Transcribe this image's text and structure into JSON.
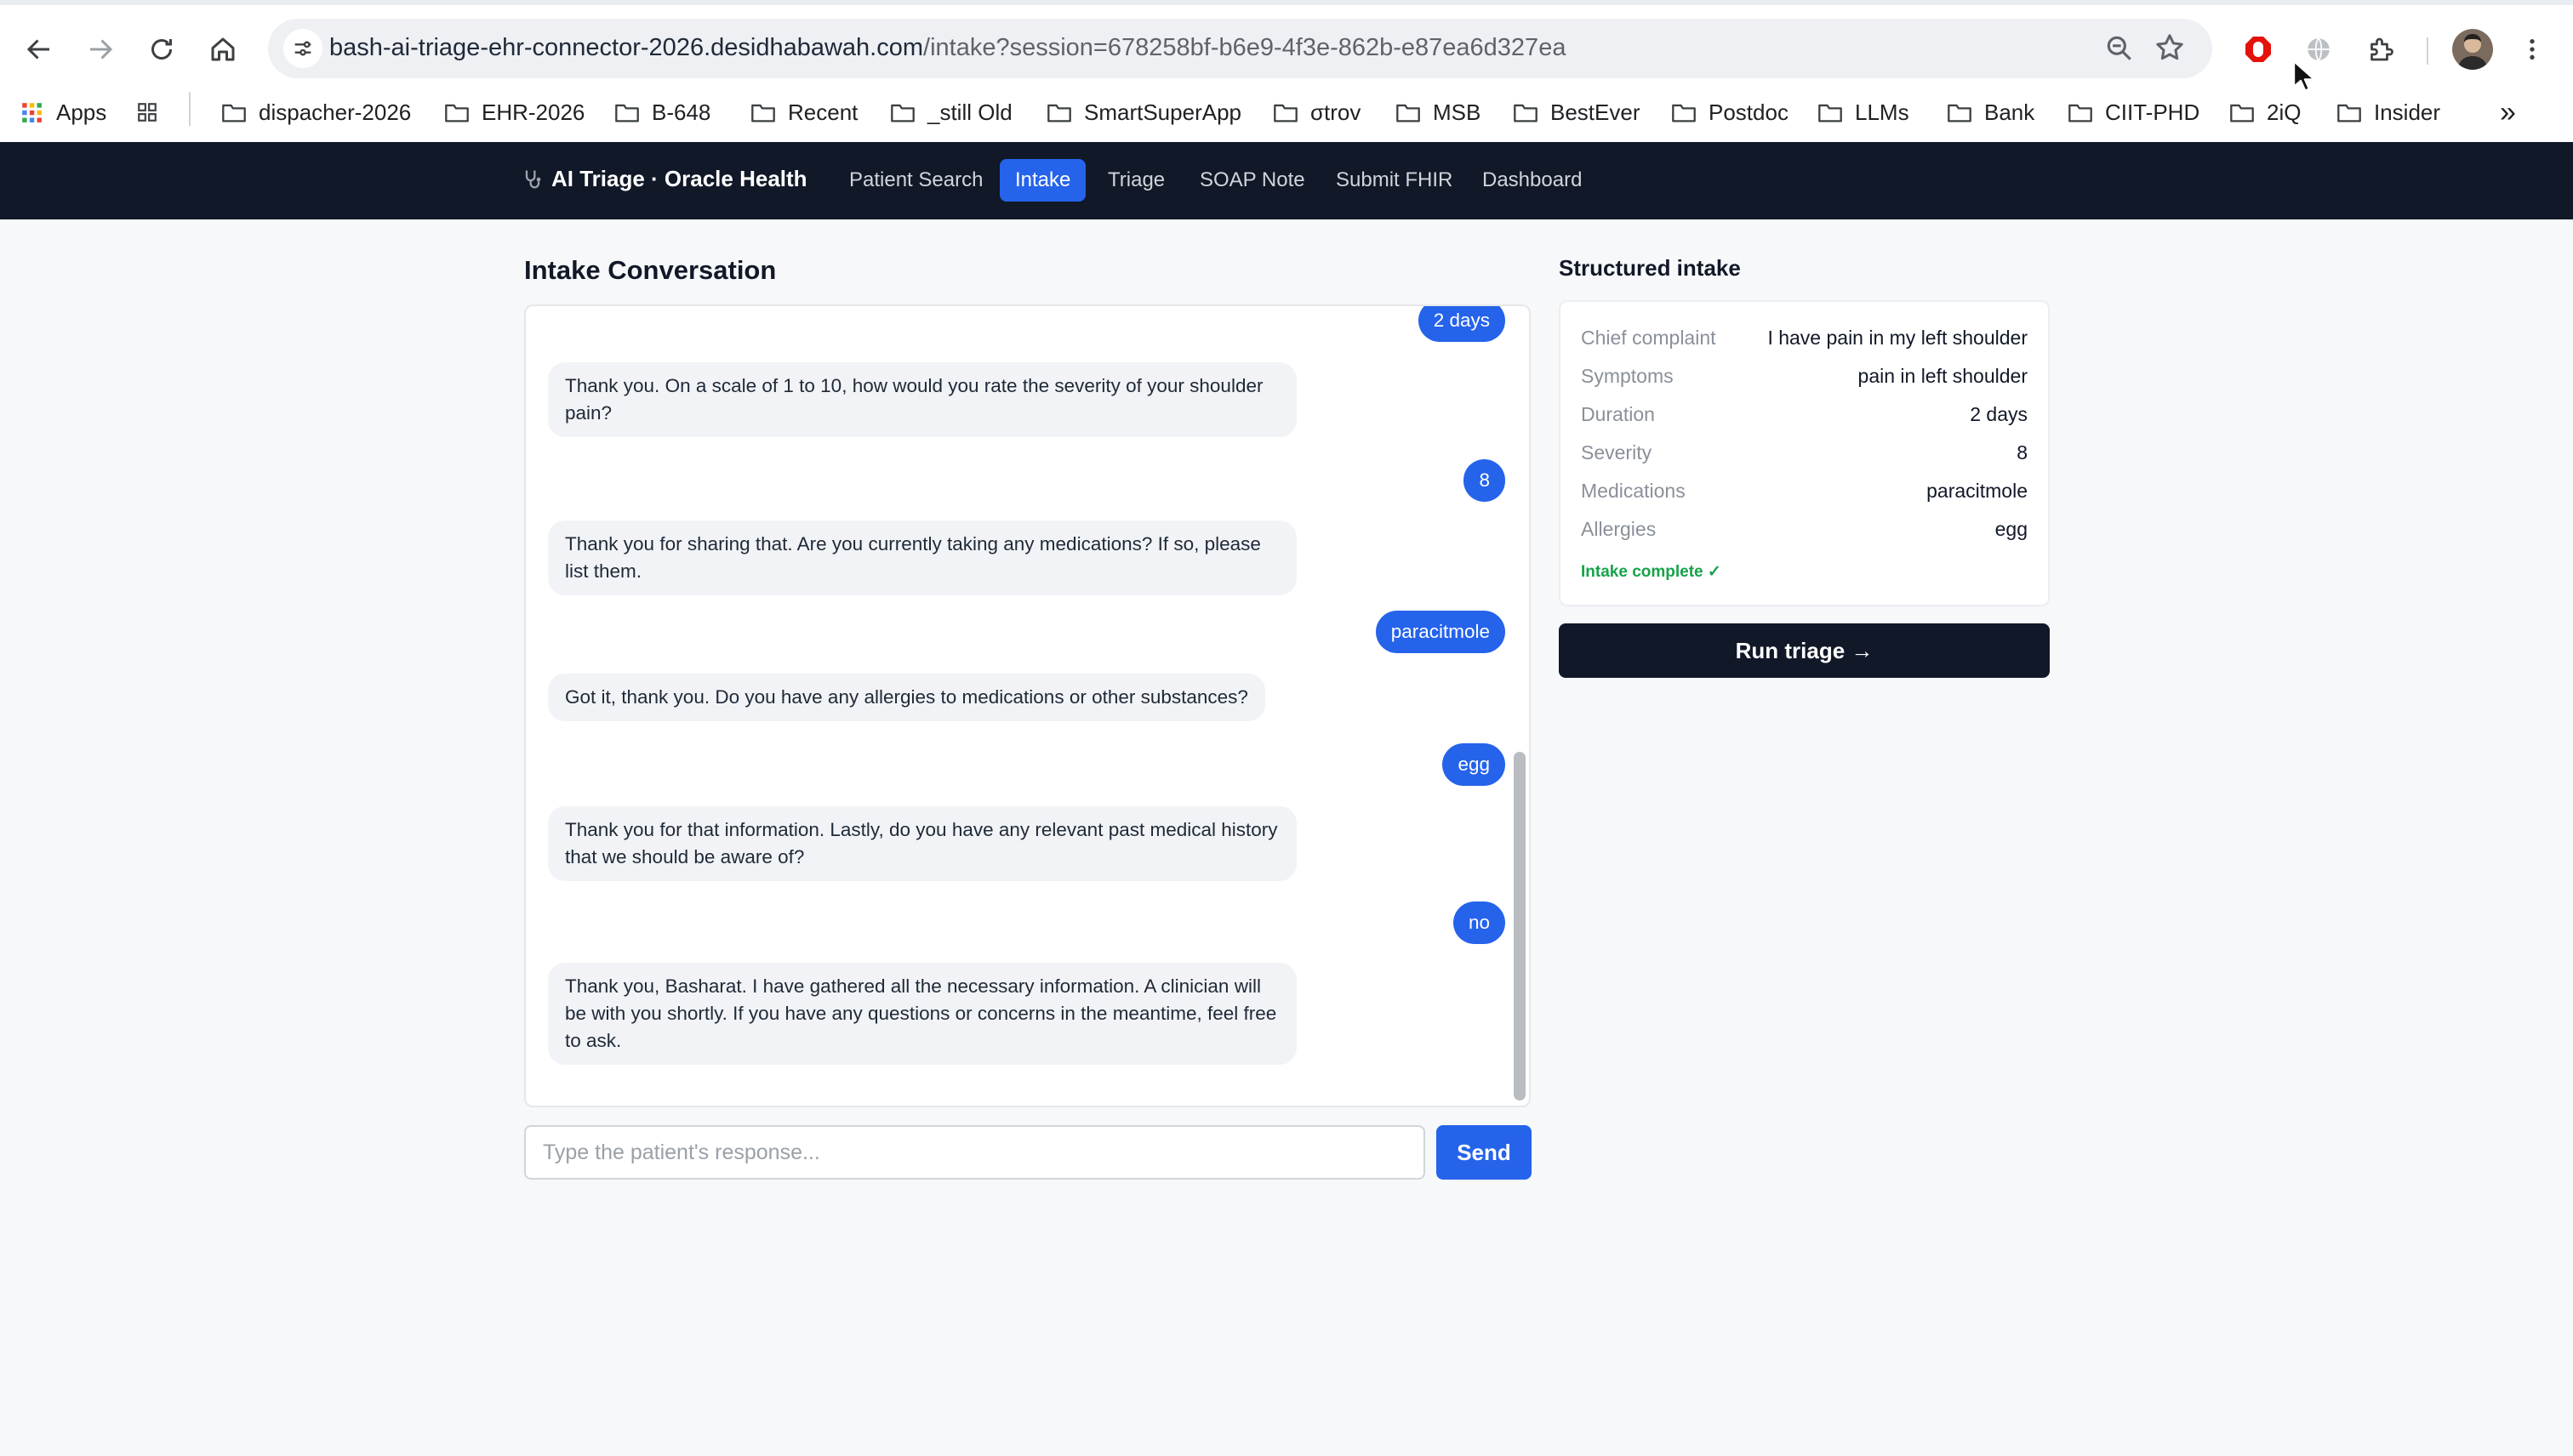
{
  "browser": {
    "url_host": "bash-ai-triage-ehr-connector-2026.desidhabawah.com",
    "url_path": "/intake?session=678258bf-b6e9-4f3e-862b-e87ea6d327ea",
    "bookmarks": [
      {
        "label": "Apps",
        "icon": "apps-grid-icon"
      },
      {
        "label": "dispacher-2026",
        "icon": "folder-icon"
      },
      {
        "label": "EHR-2026",
        "icon": "folder-icon"
      },
      {
        "label": "B-648",
        "icon": "folder-icon"
      },
      {
        "label": "Recent",
        "icon": "folder-icon"
      },
      {
        "label": "_still Old",
        "icon": "folder-icon"
      },
      {
        "label": "SmartSuperApp",
        "icon": "folder-icon"
      },
      {
        "label": "σtrov",
        "icon": "folder-icon"
      },
      {
        "label": "MSB",
        "icon": "folder-icon"
      },
      {
        "label": "BestEver",
        "icon": "folder-icon"
      },
      {
        "label": "Postdoc",
        "icon": "folder-icon"
      },
      {
        "label": "LLMs",
        "icon": "folder-icon"
      },
      {
        "label": "Bank",
        "icon": "folder-icon"
      },
      {
        "label": "CIIT-PHD",
        "icon": "folder-icon"
      },
      {
        "label": "2iQ",
        "icon": "folder-icon"
      },
      {
        "label": "Insider",
        "icon": "folder-icon"
      }
    ],
    "more_bookmarks": "»"
  },
  "app": {
    "brand": "AI Triage · Oracle Health",
    "nav": [
      {
        "label": "Patient Search",
        "active": false
      },
      {
        "label": "Intake",
        "active": true
      },
      {
        "label": "Triage",
        "active": false
      },
      {
        "label": "SOAP Note",
        "active": false
      },
      {
        "label": "Submit FHIR",
        "active": false
      },
      {
        "label": "Dashboard",
        "active": false
      }
    ],
    "accent_color": "#2563eb",
    "nav_bg_color": "#111827"
  },
  "conversation": {
    "title": "Intake Conversation",
    "messages": [
      {
        "role": "user",
        "text": "2 days"
      },
      {
        "role": "assistant",
        "text": "Thank you. On a scale of 1 to 10, how would you rate the severity of your shoulder pain?"
      },
      {
        "role": "user",
        "text": "8"
      },
      {
        "role": "assistant",
        "text": "Thank you for sharing that. Are you currently taking any medications? If so, please list them."
      },
      {
        "role": "user",
        "text": "paracitmole"
      },
      {
        "role": "assistant",
        "text": "Got it, thank you. Do you have any allergies to medications or other substances?"
      },
      {
        "role": "user",
        "text": "egg"
      },
      {
        "role": "assistant",
        "text": "Thank you for that information. Lastly, do you have any relevant past medical history that we should be aware of?"
      },
      {
        "role": "user",
        "text": "no"
      },
      {
        "role": "assistant",
        "text": "Thank you, Basharat. I have gathered all the necessary information. A clinician will be with you shortly. If you have any questions or concerns in the meantime, feel free to ask."
      }
    ],
    "input_placeholder": "Type the patient's response...",
    "input_value": "",
    "send_label": "Send"
  },
  "structured_intake": {
    "title": "Structured intake",
    "fields": [
      {
        "label": "Chief complaint",
        "value": "I have pain in my left shoulder"
      },
      {
        "label": "Symptoms",
        "value": "pain in left shoulder"
      },
      {
        "label": "Duration",
        "value": "2 days"
      },
      {
        "label": "Severity",
        "value": "8"
      },
      {
        "label": "Medications",
        "value": "paracitmole"
      },
      {
        "label": "Allergies",
        "value": "egg"
      }
    ],
    "status": "Intake complete ✓",
    "status_color": "#16a34a",
    "run_label": "Run triage →"
  }
}
